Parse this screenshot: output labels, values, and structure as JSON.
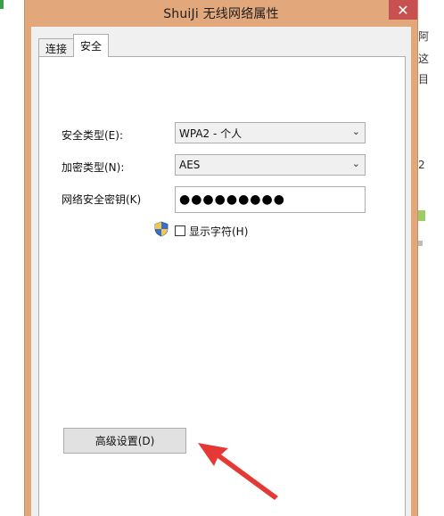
{
  "window": {
    "title": "ShuiJi 无线网络属性",
    "close_glyph": "✕"
  },
  "tabs": [
    {
      "label": "连接",
      "active": false
    },
    {
      "label": "安全",
      "active": true
    }
  ],
  "security": {
    "security_type_label": "安全类型(E):",
    "security_type_value": "WPA2 - 个人",
    "encryption_type_label": "加密类型(N):",
    "encryption_type_value": "AES",
    "network_key_label": "网络安全密钥(K)",
    "network_key_value": "●●●●●●●●●",
    "show_chars_label": "显示字符(H)",
    "show_chars_checked": false
  },
  "advanced_button_label": "高级设置(D)",
  "background_window": {
    "glyphs": [
      "阿",
      "这",
      "目",
      "2"
    ]
  },
  "colors": {
    "dialog_frame": "#e3a77c",
    "close_button": "#c75050",
    "annotation_arrow": "#e53935"
  },
  "icons": {
    "shield": "uac-shield-icon",
    "dropdown": "chevron-down-icon",
    "close": "close-icon",
    "annotation": "red-arrow-icon"
  }
}
